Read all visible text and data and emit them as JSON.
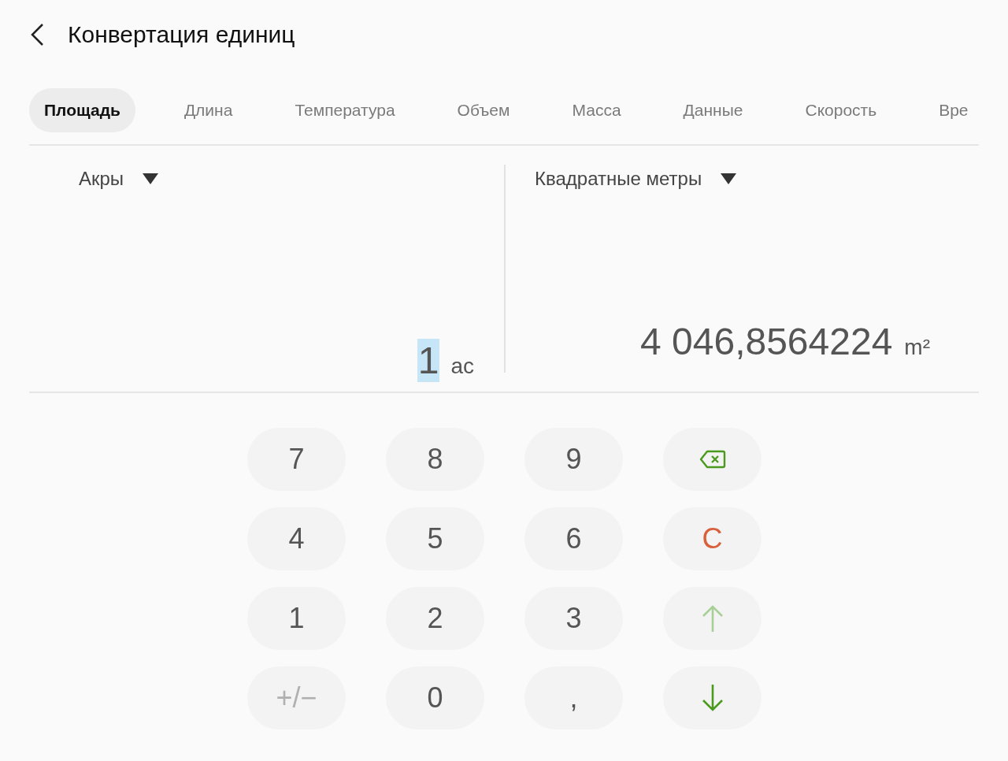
{
  "header": {
    "title": "Конвертация единиц"
  },
  "tabs": [
    {
      "label": "Площадь",
      "selected": true
    },
    {
      "label": "Длина",
      "selected": false
    },
    {
      "label": "Температура",
      "selected": false
    },
    {
      "label": "Объем",
      "selected": false
    },
    {
      "label": "Масса",
      "selected": false
    },
    {
      "label": "Данные",
      "selected": false
    },
    {
      "label": "Скорость",
      "selected": false
    },
    {
      "label": "Вре",
      "selected": false
    }
  ],
  "converter": [
    {
      "unit": "Акры",
      "value": "1",
      "symbol": "ac",
      "value_selected": true
    },
    {
      "unit": "Квадратные метры",
      "value": "4 046,8564224",
      "symbol": "m²",
      "value_selected": false
    }
  ],
  "keypad": [
    {
      "kind": "text",
      "label": "7",
      "disabled": false
    },
    {
      "kind": "text",
      "label": "8",
      "disabled": false
    },
    {
      "kind": "text",
      "label": "9",
      "disabled": false
    },
    {
      "kind": "backspace",
      "disabled": false
    },
    {
      "kind": "text",
      "label": "4",
      "disabled": false
    },
    {
      "kind": "text",
      "label": "5",
      "disabled": false
    },
    {
      "kind": "text",
      "label": "6",
      "disabled": false
    },
    {
      "kind": "clear",
      "label": "C",
      "disabled": false
    },
    {
      "kind": "text",
      "label": "1",
      "disabled": false
    },
    {
      "kind": "text",
      "label": "2",
      "disabled": false
    },
    {
      "kind": "text",
      "label": "3",
      "disabled": false
    },
    {
      "kind": "up",
      "disabled": true
    },
    {
      "kind": "text",
      "label": "+/−",
      "disabled": true
    },
    {
      "kind": "text",
      "label": "0",
      "disabled": false
    },
    {
      "kind": "text",
      "label": ",",
      "disabled": false
    },
    {
      "kind": "down",
      "disabled": false
    }
  ]
}
